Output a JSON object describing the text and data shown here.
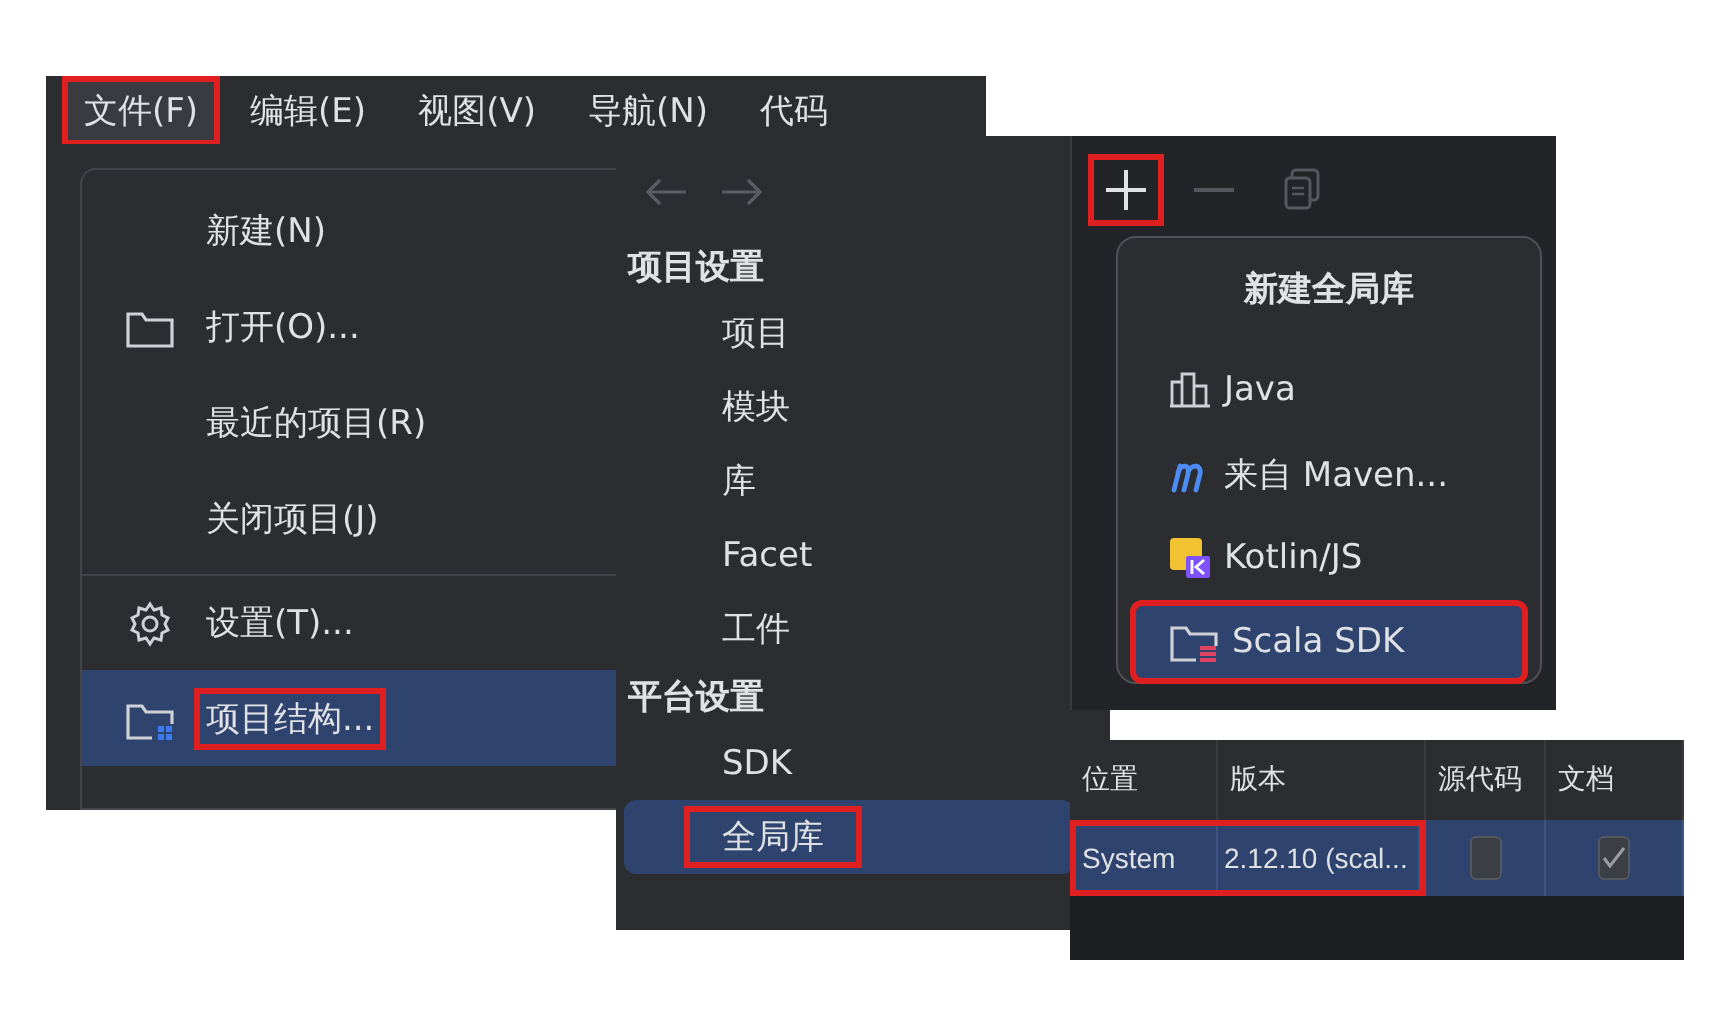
{
  "menu_bar": {
    "items": [
      {
        "label": "文件(F)",
        "selected": true,
        "highlighted": true
      },
      {
        "label": "编辑(E)",
        "selected": false,
        "highlighted": false
      },
      {
        "label": "视图(V)",
        "selected": false,
        "highlighted": false
      },
      {
        "label": "导航(N)",
        "selected": false,
        "highlighted": false
      },
      {
        "label": "代码",
        "selected": false,
        "highlighted": false
      }
    ]
  },
  "file_menu": {
    "items": [
      {
        "label": "新建(N)",
        "kind": "plain",
        "selected": false,
        "highlighted": false,
        "separator_before": false
      },
      {
        "label": "打开(O)...",
        "kind": "folder",
        "selected": false,
        "highlighted": false,
        "separator_before": false
      },
      {
        "label": "最近的项目(R)",
        "kind": "plain",
        "selected": false,
        "highlighted": false,
        "separator_before": false
      },
      {
        "label": "关闭项目(J)",
        "kind": "plain",
        "selected": false,
        "highlighted": false,
        "separator_before": false
      },
      {
        "label": "设置(T)...",
        "kind": "gear",
        "selected": false,
        "highlighted": false,
        "separator_before": true
      },
      {
        "label": "项目结构...",
        "kind": "structure",
        "selected": true,
        "highlighted": true,
        "separator_before": false
      }
    ]
  },
  "project_structure": {
    "sections": [
      {
        "title": "项目设置",
        "items": [
          {
            "label": "项目",
            "selected": false,
            "highlighted": false
          },
          {
            "label": "模块",
            "selected": false,
            "highlighted": false
          },
          {
            "label": "库",
            "selected": false,
            "highlighted": false
          },
          {
            "label": "Facet",
            "selected": false,
            "highlighted": false
          },
          {
            "label": "工件",
            "selected": false,
            "highlighted": false
          }
        ]
      },
      {
        "title": "平台设置",
        "items": [
          {
            "label": "SDK",
            "selected": false,
            "highlighted": false
          },
          {
            "label": "全局库",
            "selected": true,
            "highlighted": true
          }
        ]
      }
    ]
  },
  "libraries_toolbar": {
    "buttons": [
      {
        "kind": "add",
        "disabled": false,
        "highlighted": true
      },
      {
        "kind": "remove",
        "disabled": true,
        "highlighted": false
      },
      {
        "kind": "copy",
        "disabled": true,
        "highlighted": false
      }
    ]
  },
  "new_library_popup": {
    "title": "新建全局库",
    "items": [
      {
        "label": "Java",
        "kind": "java",
        "selected": false,
        "highlighted": false
      },
      {
        "label": "来自 Maven...",
        "kind": "maven",
        "selected": false,
        "highlighted": false
      },
      {
        "label": "Kotlin/JS",
        "kind": "kotlin",
        "selected": false,
        "highlighted": false
      },
      {
        "label": "Scala SDK",
        "kind": "scala",
        "selected": true,
        "highlighted": true
      }
    ]
  },
  "table": {
    "columns": [
      "位置",
      "版本",
      "源代码",
      "文档"
    ],
    "rows": [
      {
        "location": "System",
        "version": "2.12.10 (scal...",
        "sources": false,
        "docs": true,
        "selected": true,
        "highlighted": true
      }
    ]
  }
}
